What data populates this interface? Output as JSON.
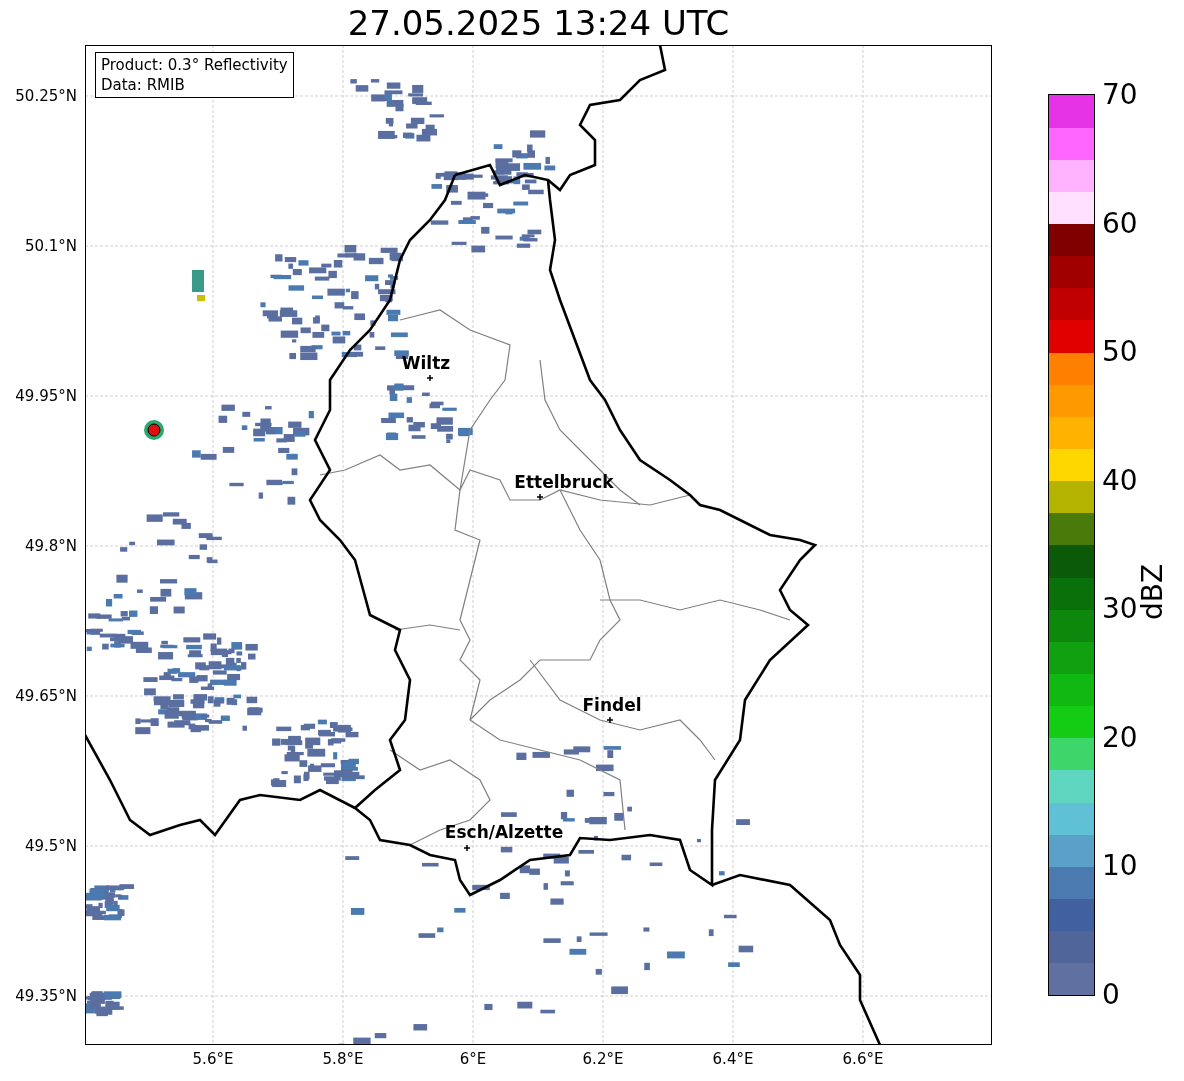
{
  "title": "27.05.2025 13:24 UTC",
  "info_box": [
    "Product: 0.3° Reflectivity",
    "Data: RMIB"
  ],
  "lat_ticks": [
    "50.25°N",
    "50.1°N",
    "49.95°N",
    "49.8°N",
    "49.65°N",
    "49.5°N",
    "49.35°N"
  ],
  "lon_ticks": [
    "5.6°E",
    "5.8°E",
    "6°E",
    "6.2°E",
    "6.4°E",
    "6.6°E"
  ],
  "cities": [
    {
      "name": "Wiltz"
    },
    {
      "name": "Ettelbruck"
    },
    {
      "name": "Findel"
    },
    {
      "name": "Esch/Alzette"
    }
  ],
  "colorbar": {
    "label": "dBZ",
    "ticks": [
      "70",
      "60",
      "50",
      "40",
      "30",
      "20",
      "10",
      "0"
    ],
    "colors": [
      {
        "color": "#6070a0"
      },
      {
        "color": "#50659a"
      },
      {
        "color": "#4060a0"
      },
      {
        "color": "#4a7ab0"
      },
      {
        "color": "#5aa0c8"
      },
      {
        "color": "#5fc0d6"
      },
      {
        "color": "#5fd6c0"
      },
      {
        "color": "#3dd66b"
      },
      {
        "color": "#14cc14"
      },
      {
        "color": "#12b812"
      },
      {
        "color": "#10a010"
      },
      {
        "color": "#0d880d"
      },
      {
        "color": "#0a700a"
      },
      {
        "color": "#0a5a0a"
      },
      {
        "color": "#4a7a0a"
      },
      {
        "color": "#b3b300"
      },
      {
        "color": "#ffd700"
      },
      {
        "color": "#ffb300"
      },
      {
        "color": "#ff9900"
      },
      {
        "color": "#ff8000"
      },
      {
        "color": "#e00000"
      },
      {
        "color": "#c00000"
      },
      {
        "color": "#a00000"
      },
      {
        "color": "#800000"
      },
      {
        "color": "#ffe0ff"
      },
      {
        "color": "#ffb3ff"
      },
      {
        "color": "#ff66ff"
      },
      {
        "color": "#e633e6"
      }
    ]
  }
}
